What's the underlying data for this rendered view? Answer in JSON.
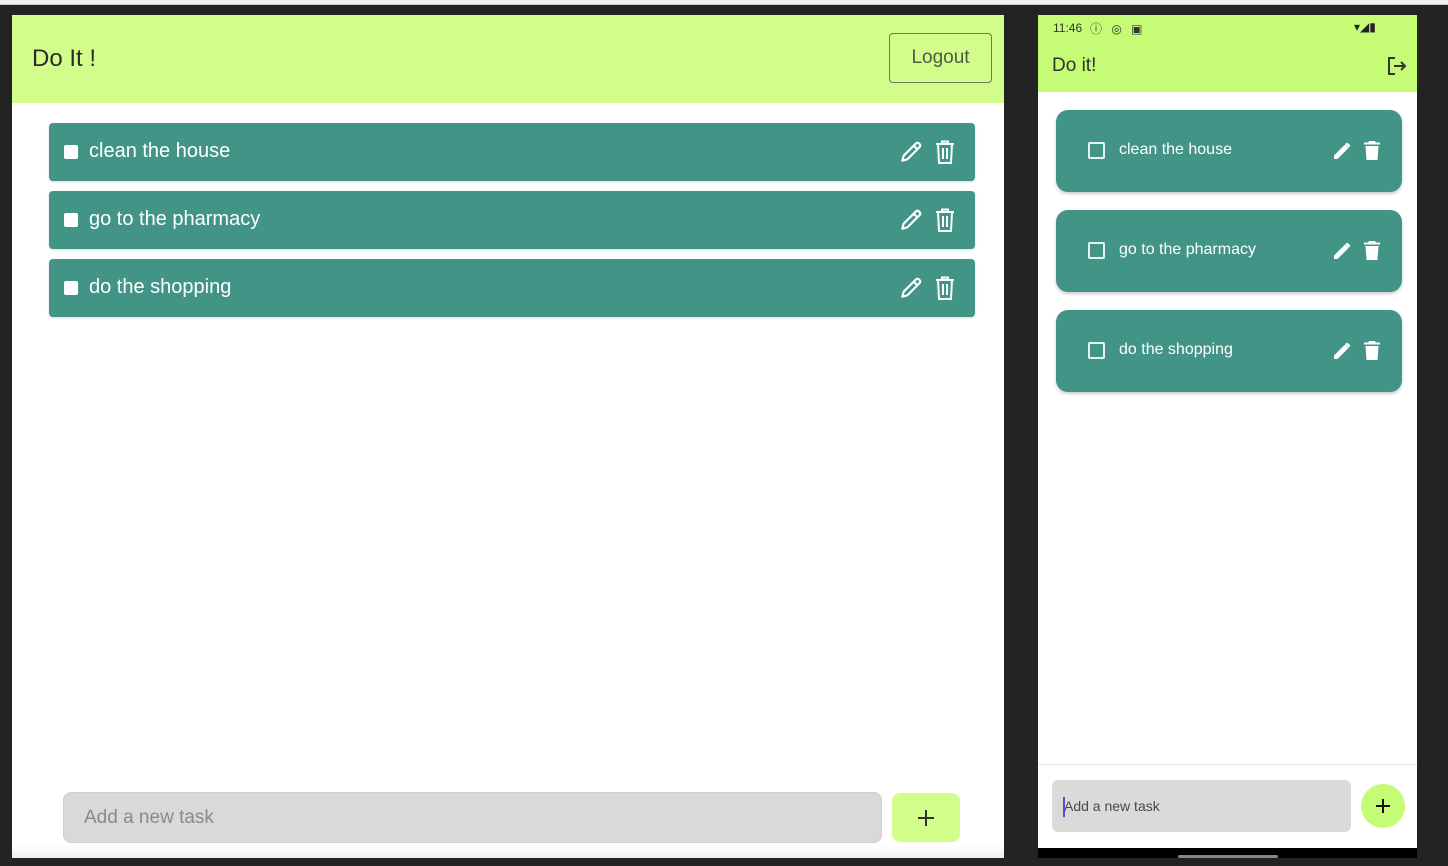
{
  "web": {
    "title": "Do It !",
    "logout_label": "Logout",
    "tasks": [
      {
        "text": "clean the house",
        "done": false
      },
      {
        "text": "go to the pharmacy",
        "done": false
      },
      {
        "text": "do the shopping",
        "done": false
      }
    ],
    "input_placeholder": "Add a new task",
    "add_icon": "plus-icon"
  },
  "mobile": {
    "status": {
      "time": "11:46",
      "left_icons": "ⓘ ◎ ▣",
      "right_icons": "▾◢▮"
    },
    "title": "Do it!",
    "logout_icon": "logout-icon",
    "tasks": [
      {
        "text": "clean the house",
        "done": false
      },
      {
        "text": "go to the pharmacy",
        "done": false
      },
      {
        "text": "do the shopping",
        "done": false
      }
    ],
    "input_placeholder": "Add a new task",
    "add_icon": "plus-icon"
  },
  "colors": {
    "header_web": "#d2fd8a",
    "header_mobile": "#c5fb75",
    "task_bg": "#429486",
    "input_bg": "#d9d9d9"
  }
}
